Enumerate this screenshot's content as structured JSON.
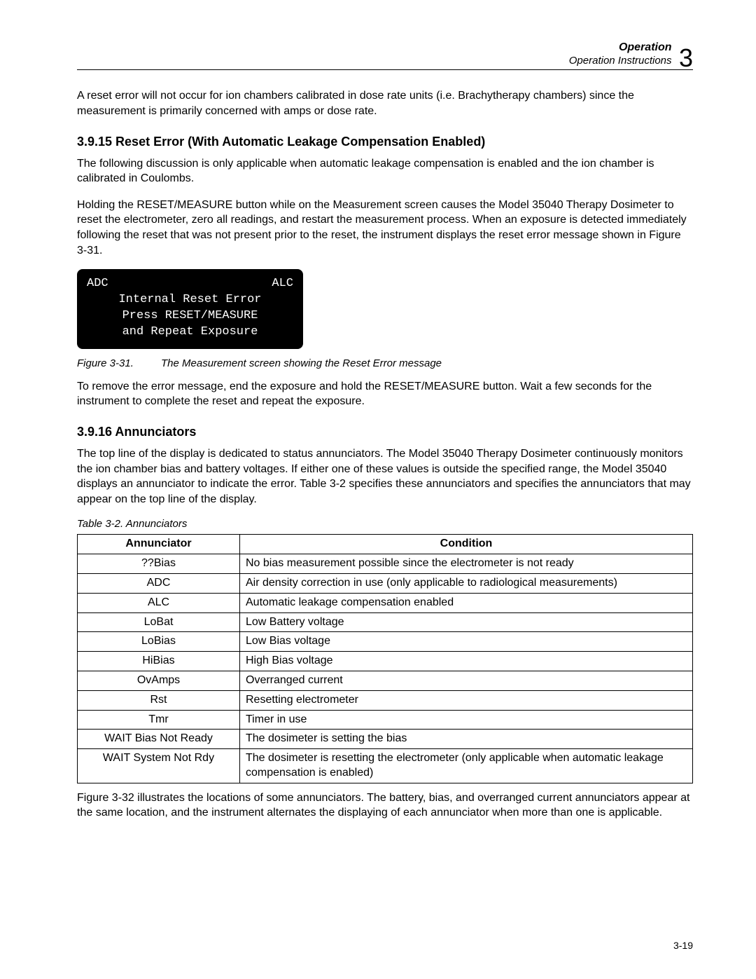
{
  "header": {
    "title_bold": "Operation",
    "subtitle_italic": "Operation Instructions",
    "chapter_number": "3"
  },
  "para_intro": "A reset error will not occur for ion chambers calibrated in dose rate units (i.e. Brachytherapy chambers) since the measurement is primarily concerned with amps or dose rate.",
  "section_3915": {
    "heading": "3.9.15 Reset Error (With Automatic Leakage Compensation Enabled)",
    "p1": "The following discussion is only applicable when automatic leakage compensation is enabled and the ion chamber is calibrated in Coulombs.",
    "p2": "Holding the RESET/MEASURE button while on the Measurement screen causes the Model 35040 Therapy Dosimeter to reset the electrometer, zero all readings, and restart the measurement process. When an exposure is detected immediately following the reset that was not present prior to the reset, the instrument displays the reset error message shown in Figure 3-31.",
    "lcd": {
      "row1_left": "ADC",
      "row1_right": "ALC",
      "row2": "Internal Reset Error",
      "row3": "Press RESET/MEASURE",
      "row4": "and Repeat Exposure"
    },
    "fig_label": "Figure 3-31.",
    "fig_text": "The Measurement screen showing the Reset Error message",
    "p3": "To remove the error message, end the exposure and hold the RESET/MEASURE button.  Wait a few seconds for the instrument to complete the reset and repeat the exposure."
  },
  "section_3916": {
    "heading": "3.9.16 Annunciators",
    "p1": "The top line of the display is dedicated to status annunciators.  The Model 35040 Therapy Dosimeter continuously monitors the ion chamber bias and battery voltages.  If either one of these values is outside the specified range, the Model 35040 displays an annunciator to indicate the error.  Table 3-2 specifies these annunciators and specifies the annunciators that may appear on the top line of the display.",
    "table_caption": "Table 3-2.  Annunciators",
    "table": {
      "head_a": "Annunciator",
      "head_b": "Condition",
      "rows": [
        {
          "a": "??Bias",
          "b": "No bias measurement possible since the electrometer is not ready"
        },
        {
          "a": "ADC",
          "b": "Air density correction in use (only applicable to radiological measurements)"
        },
        {
          "a": "ALC",
          "b": "Automatic leakage compensation enabled"
        },
        {
          "a": "LoBat",
          "b": "Low Battery voltage"
        },
        {
          "a": "LoBias",
          "b": "Low Bias voltage"
        },
        {
          "a": "HiBias",
          "b": "High Bias voltage"
        },
        {
          "a": "OvAmps",
          "b": "Overranged current"
        },
        {
          "a": "Rst",
          "b": "Resetting electrometer"
        },
        {
          "a": "Tmr",
          "b": "Timer in use"
        },
        {
          "a": "WAIT Bias Not Ready",
          "b": "The dosimeter is setting the bias"
        },
        {
          "a": "WAIT System Not Rdy",
          "b": "The dosimeter is resetting the electrometer (only applicable when automatic leakage compensation is enabled)"
        }
      ]
    },
    "p2": "Figure 3-32 illustrates the locations of some annunciators.  The battery, bias, and overranged current annunciators appear at the same location, and the instrument alternates the displaying of each annunciator when more than one is applicable."
  },
  "page_number": "3-19"
}
